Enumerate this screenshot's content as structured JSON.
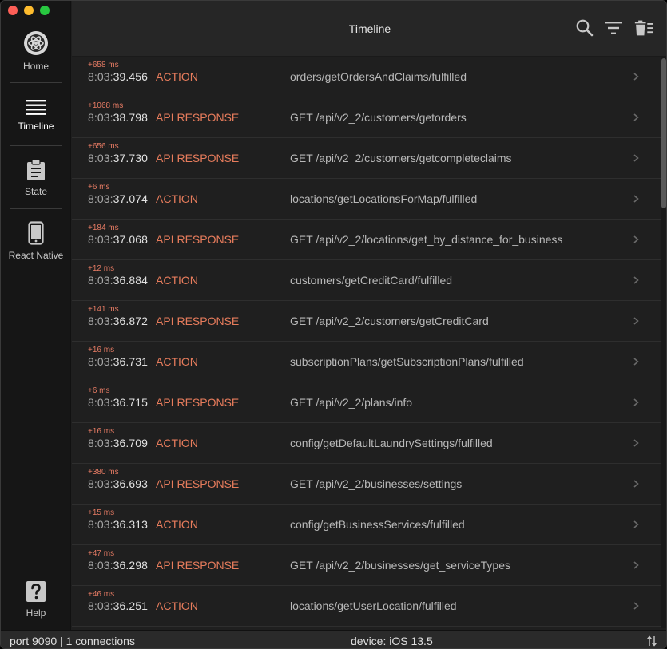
{
  "window": {
    "title": "Timeline"
  },
  "sidebar": {
    "items": [
      {
        "label": "Home",
        "icon": "reactotron-logo-icon",
        "active": false
      },
      {
        "label": "Timeline",
        "icon": "list-icon",
        "active": true
      },
      {
        "label": "State",
        "icon": "clipboard-icon",
        "active": false
      },
      {
        "label": "React Native",
        "icon": "phone-icon",
        "active": false
      }
    ],
    "help": {
      "label": "Help",
      "icon": "help-icon"
    }
  },
  "header": {
    "title": "Timeline",
    "icons": [
      "search-icon",
      "filter-icon",
      "trash-icon"
    ]
  },
  "timeline": {
    "rows": [
      {
        "delta": "+658 ms",
        "time_prefix": "8:03:",
        "time_main": "39.456",
        "type": "ACTION",
        "name": "orders/getOrdersAndClaims/fulfilled"
      },
      {
        "delta": "+1068 ms",
        "time_prefix": "8:03:",
        "time_main": "38.798",
        "type": "API RESPONSE",
        "name": "GET /api/v2_2/customers/getorders"
      },
      {
        "delta": "+656 ms",
        "time_prefix": "8:03:",
        "time_main": "37.730",
        "type": "API RESPONSE",
        "name": "GET /api/v2_2/customers/getcompleteclaims"
      },
      {
        "delta": "+6 ms",
        "time_prefix": "8:03:",
        "time_main": "37.074",
        "type": "ACTION",
        "name": "locations/getLocationsForMap/fulfilled"
      },
      {
        "delta": "+184 ms",
        "time_prefix": "8:03:",
        "time_main": "37.068",
        "type": "API RESPONSE",
        "name": "GET /api/v2_2/locations/get_by_distance_for_business"
      },
      {
        "delta": "+12 ms",
        "time_prefix": "8:03:",
        "time_main": "36.884",
        "type": "ACTION",
        "name": "customers/getCreditCard/fulfilled"
      },
      {
        "delta": "+141 ms",
        "time_prefix": "8:03:",
        "time_main": "36.872",
        "type": "API RESPONSE",
        "name": "GET /api/v2_2/customers/getCreditCard"
      },
      {
        "delta": "+16 ms",
        "time_prefix": "8:03:",
        "time_main": "36.731",
        "type": "ACTION",
        "name": "subscriptionPlans/getSubscriptionPlans/fulfilled"
      },
      {
        "delta": "+6 ms",
        "time_prefix": "8:03:",
        "time_main": "36.715",
        "type": "API RESPONSE",
        "name": "GET /api/v2_2/plans/info"
      },
      {
        "delta": "+16 ms",
        "time_prefix": "8:03:",
        "time_main": "36.709",
        "type": "ACTION",
        "name": "config/getDefaultLaundrySettings/fulfilled"
      },
      {
        "delta": "+380 ms",
        "time_prefix": "8:03:",
        "time_main": "36.693",
        "type": "API RESPONSE",
        "name": "GET /api/v2_2/businesses/settings"
      },
      {
        "delta": "+15 ms",
        "time_prefix": "8:03:",
        "time_main": "36.313",
        "type": "ACTION",
        "name": "config/getBusinessServices/fulfilled"
      },
      {
        "delta": "+47 ms",
        "time_prefix": "8:03:",
        "time_main": "36.298",
        "type": "API RESPONSE",
        "name": "GET /api/v2_2/businesses/get_serviceTypes"
      },
      {
        "delta": "+46 ms",
        "time_prefix": "8:03:",
        "time_main": "36.251",
        "type": "ACTION",
        "name": "locations/getUserLocation/fulfilled"
      }
    ]
  },
  "footer": {
    "connection": "port 9090 | 1 connections",
    "device": "device: iOS 13.5",
    "sort_icon": "sort-icon"
  },
  "colors": {
    "accent": "#e77c5c",
    "background": "#1f1f1f",
    "sidebar": "#161616"
  }
}
